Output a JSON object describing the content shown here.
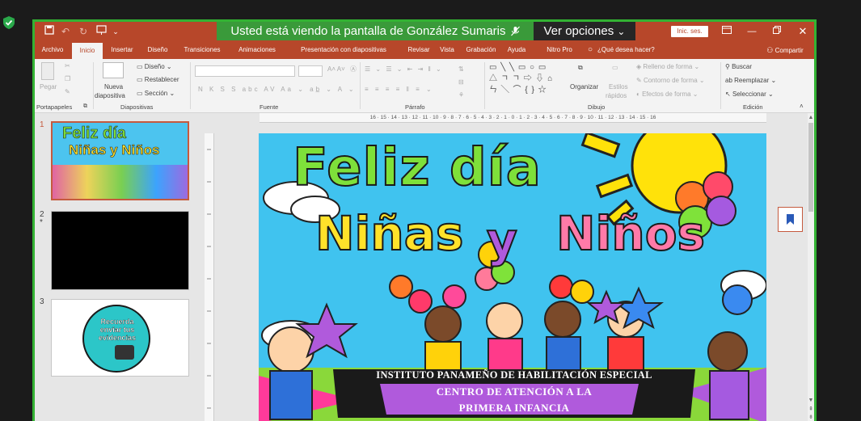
{
  "app": {
    "share_banner": "Usted está viendo la pantalla de González Sumaris",
    "view_options": "Ver opciones",
    "sign_in": "Inic. ses.",
    "colors": {
      "accent": "#b7472a",
      "share": "#3a9a3a",
      "frame": "#33b233"
    }
  },
  "tabs": [
    "Archivo",
    "Inicio",
    "Insertar",
    "Diseño",
    "Transiciones",
    "Animaciones",
    "Presentación con diapositivas",
    "Revisar",
    "Vista",
    "Grabación",
    "Ayuda",
    "Nitro Pro"
  ],
  "tell_me": "¿Qué desea hacer?",
  "share": "Compartir",
  "ribbon": {
    "clipboard": {
      "paste": "Pegar",
      "label": "Portapapeles"
    },
    "slides": {
      "new_slide_1": "Nueva",
      "new_slide_2": "diapositiva",
      "layout": "Diseño",
      "reset": "Restablecer",
      "section": "Sección",
      "label": "Diapositivas"
    },
    "font": {
      "label": "Fuente"
    },
    "paragraph": {
      "label": "Párrafo"
    },
    "drawing": {
      "arrange": "Organizar",
      "styles_1": "Estilos",
      "styles_2": "rápidos",
      "fill": "Relleno de forma",
      "outline": "Contorno de forma",
      "effects": "Efectos de forma",
      "label": "Dibujo"
    },
    "editing": {
      "find": "Buscar",
      "replace": "Reemplazar",
      "select": "Seleccionar",
      "label": "Edición"
    }
  },
  "ruler": {
    "horizontal": "16 · 15 · 14 · 13 · 12 · 11 · 10 · 9 · 8 · 7 · 6 · 5 · 4 · 3 · 2 · 1 · 0 · 1 · 2 · 3 · 4 · 5 · 6 · 7 · 8 · 9 · 10 · 11 · 12 · 13 · 14 · 15 · 16"
  },
  "thumbnails": [
    {
      "number": "1",
      "title_1": "Feliz día",
      "title_2": "Niñas y Niños"
    },
    {
      "number": "2",
      "marker": "*"
    },
    {
      "number": "3",
      "text": "Recuerda enviar tus evidencias"
    }
  ],
  "slide": {
    "title_line1": "Feliz día",
    "title_line2a": "Niñas",
    "title_line2b": "y",
    "title_line2c": "Niños",
    "banner_1": "INSTITUTO PANAMEÑO DE HABILITACIÓN ESPECIAL",
    "banner_2": "CENTRO DE ATENCIÓN A LA",
    "banner_3": "PRIMERA INFANCIA"
  }
}
